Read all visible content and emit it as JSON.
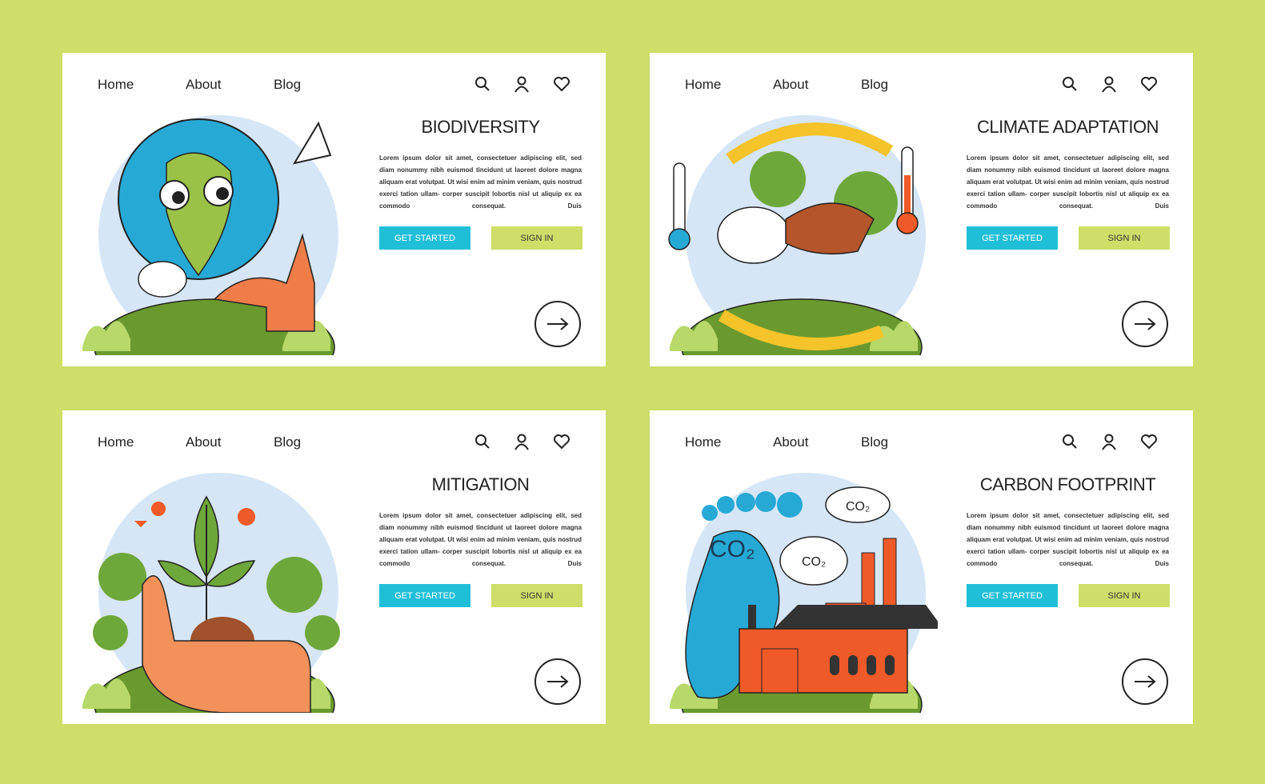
{
  "colors": {
    "background": "#cddf68",
    "get_started": "#20bfd8",
    "sign_in": "#cddf68"
  },
  "cards": [
    {
      "nav": [
        "Home",
        "About",
        "Blog"
      ],
      "icons": [
        "search-icon",
        "user-icon",
        "heart-icon"
      ],
      "title": "BIODIVERSITY",
      "body": "Lorem ipsum dolor sit amet, consectetuer adipiscing elit, sed diam nonummy nibh euismod tincidunt ut laoreet dolore magna aliquam erat volutpat. Ut wisi enim ad minim veniam, quis nostrud exerci tation ullam- corper suscipit lobortis nisl ut aliquip ex ea commodo consequat. Duis",
      "get_started": "GET STARTED",
      "sign_in": "SIGN IN",
      "illustration": "earth-with-animals"
    },
    {
      "nav": [
        "Home",
        "About",
        "Blog"
      ],
      "icons": [
        "search-icon",
        "user-icon",
        "heart-icon"
      ],
      "title": "CLIMATE ADAPTATION",
      "body": "Lorem ipsum dolor sit amet, consectetuer adipiscing elit, sed diam nonummy nibh euismod tincidunt ut laoreet dolore magna aliquam erat volutpat. Ut wisi enim ad minim veniam, quis nostrud exerci tation ullam- corper suscipit lobortis nisl ut aliquip ex ea commodo consequat. Duis",
      "get_started": "GET STARTED",
      "sign_in": "SIGN IN",
      "illustration": "hare-with-thermometers"
    },
    {
      "nav": [
        "Home",
        "About",
        "Blog"
      ],
      "icons": [
        "search-icon",
        "user-icon",
        "heart-icon"
      ],
      "title": "MITIGATION",
      "body": "Lorem ipsum dolor sit amet, consectetuer adipiscing elit, sed diam nonummy nibh euismod tincidunt ut laoreet dolore magna aliquam erat volutpat. Ut wisi enim ad minim veniam, quis nostrud exerci tation ullam- corper suscipit lobortis nisl ut aliquip ex ea commodo consequat. Duis",
      "get_started": "GET STARTED",
      "sign_in": "SIGN IN",
      "illustration": "hand-holding-plant"
    },
    {
      "nav": [
        "Home",
        "About",
        "Blog"
      ],
      "icons": [
        "search-icon",
        "user-icon",
        "heart-icon"
      ],
      "title": "CARBON FOOTPRINT",
      "body": "Lorem ipsum dolor sit amet, consectetuer adipiscing elit, sed diam nonummy nibh euismod tincidunt ut laoreet dolore magna aliquam erat volutpat. Ut wisi enim ad minim veniam, quis nostrud exerci tation ullam- corper suscipit lobortis nisl ut aliquip ex ea commodo consequat. Duis",
      "get_started": "GET STARTED",
      "sign_in": "SIGN IN",
      "illustration": "footprint-and-factory",
      "co2_labels": [
        "CO₂",
        "CO₂",
        "CO₂"
      ]
    }
  ]
}
